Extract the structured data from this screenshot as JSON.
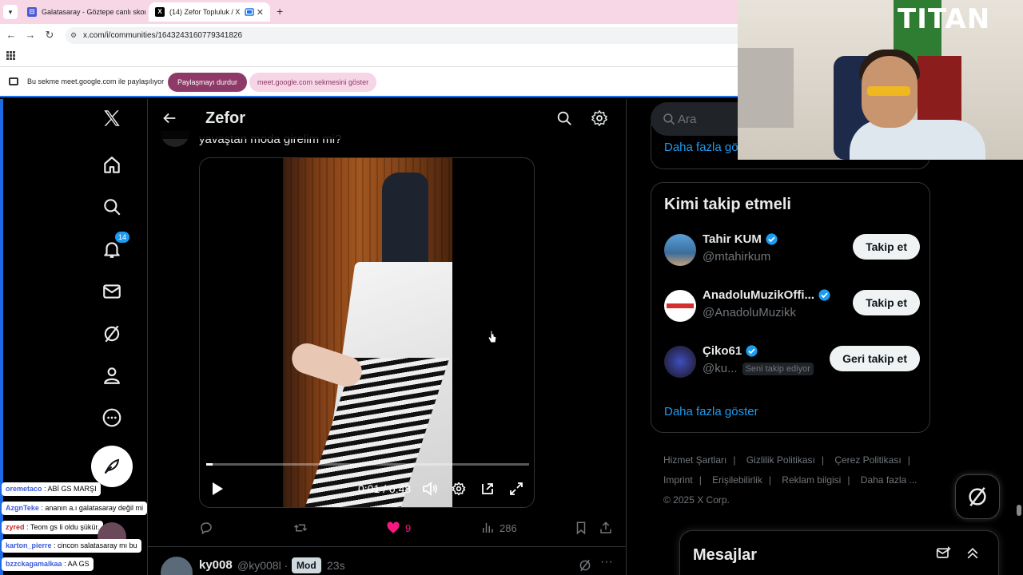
{
  "browser": {
    "tabs": [
      {
        "title": "Galatasaray - Göztepe canlı skor",
        "active": false
      },
      {
        "title": "(14) Zefor Topluluk / X",
        "active": true
      }
    ],
    "url": "x.com/i/communities/1643243160779341826",
    "share_bar": {
      "message": "Bu sekme meet.google.com ile paylaşılıyor",
      "stop_button": "Paylaşmayı durdur",
      "show_button": "meet.google.com sekmesini göster"
    }
  },
  "x": {
    "header_title": "Zefor",
    "nav": {
      "notifications_badge": "14"
    },
    "post": {
      "text": "yavaştan moda girelim mi?",
      "video": {
        "time": "0:01 / 0:48",
        "progress_fraction": 0.02
      },
      "likes": "9",
      "views": "286"
    },
    "next_post": {
      "name": "ky008",
      "handle": "@ky008l",
      "dot": "·",
      "badge": "Mod",
      "time": "23s"
    },
    "search": {
      "placeholder": "Ara",
      "more_link": "Daha fazla göster"
    },
    "who_to_follow": {
      "title": "Kimi takip etmeli",
      "users": [
        {
          "name": "Tahir KUM",
          "handle": "@mtahirkum",
          "button": "Takip et",
          "follows_you": ""
        },
        {
          "name": "AnadoluMuzikOffi...",
          "handle": "@AnadoluMuzikk",
          "button": "Takip et",
          "follows_you": ""
        },
        {
          "name": "Çiko61",
          "handle": "@ku...",
          "button": "Geri takip et",
          "follows_you": "Seni takip ediyor"
        }
      ],
      "more_link": "Daha fazla göster"
    },
    "footer": {
      "links": [
        "Hizmet Şartları",
        "Gizlilik Politikası",
        "Çerez Politikası",
        "Imprint",
        "Erişilebilirlik",
        "Reklam bilgisi",
        "Daha fazla ..."
      ],
      "copyright": "© 2025 X Corp."
    },
    "messages_title": "Mesajlar",
    "colors": {
      "accent": "#1d9bf0",
      "like": "#f91880",
      "background": "#000000"
    }
  },
  "webcam": {
    "logo": "TITAN"
  },
  "chat": [
    {
      "user": "oremetaco",
      "text": ": ABİ GS MARŞI"
    },
    {
      "user": "AzgnTeke",
      "text": ": ananın a.ı galatasaray değil mi"
    },
    {
      "user": "zyred",
      "text": ": Teom gs li oldu şükür."
    },
    {
      "user": "karton_pierre",
      "text": ": cincon salatasaray mı bu"
    },
    {
      "user": "bzzckagamalkaa",
      "text": ": AA GS"
    }
  ]
}
